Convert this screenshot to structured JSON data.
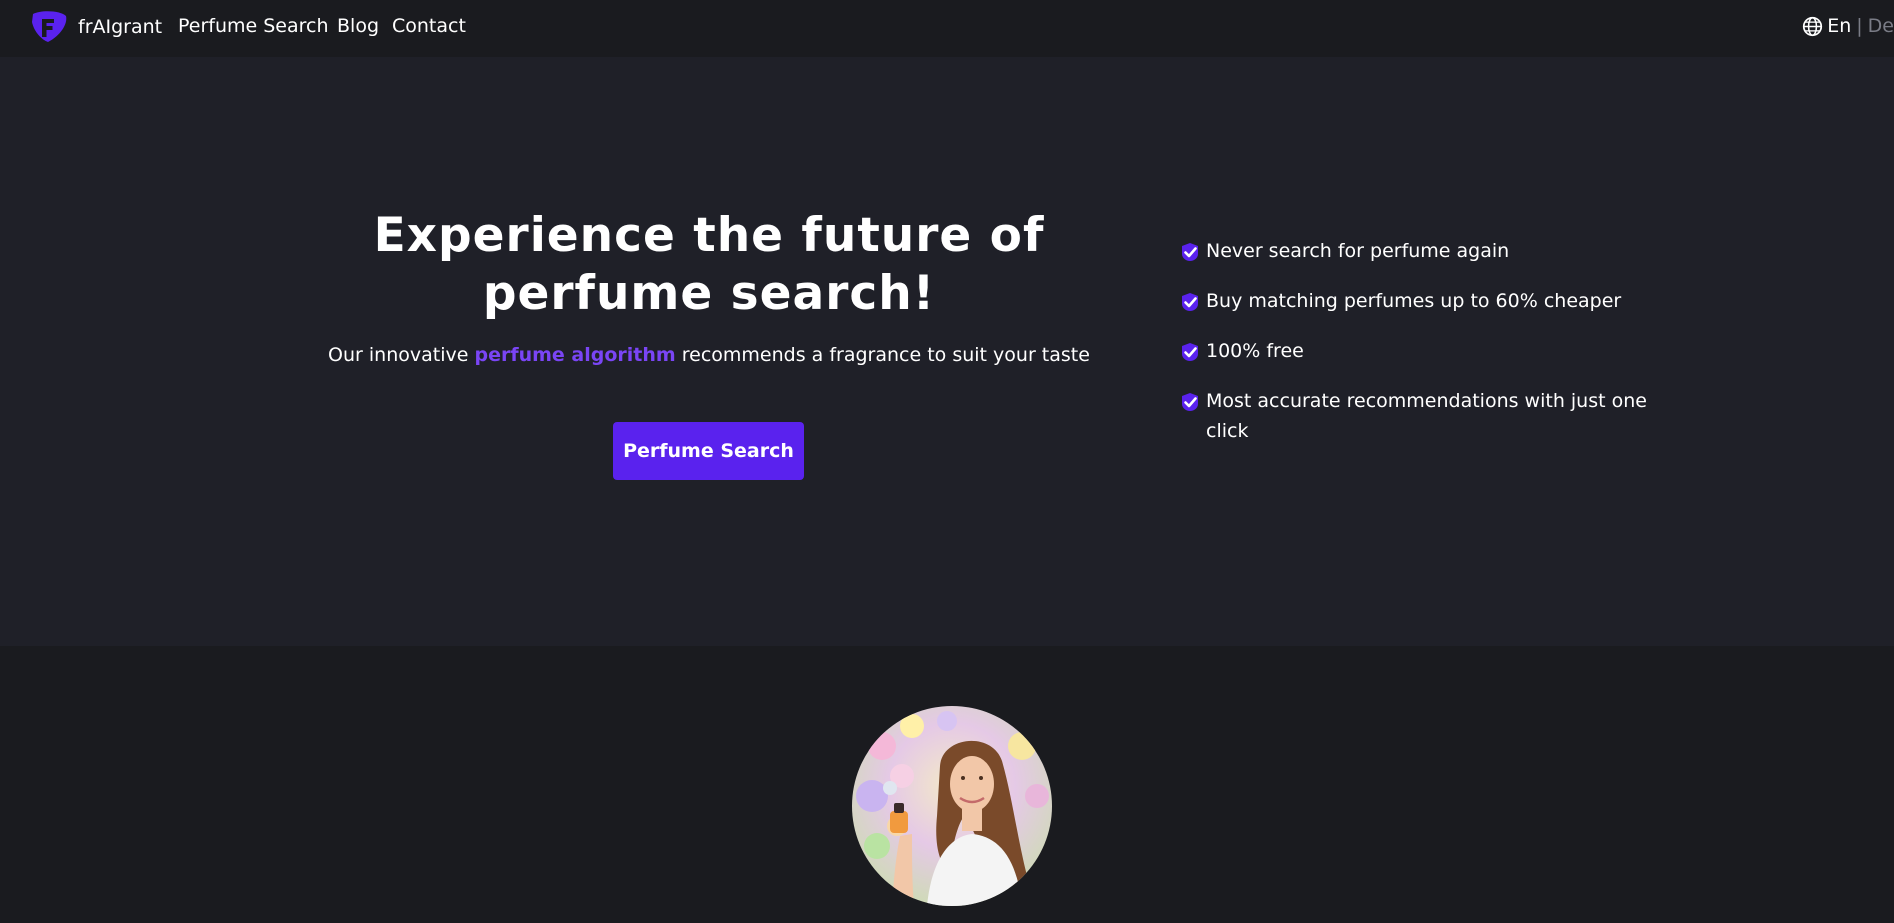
{
  "brand": {
    "name": "frAIgrant",
    "logo_icon": "logo-f-icon"
  },
  "nav": {
    "links": [
      "Perfume Search",
      "Blog",
      "Contact"
    ]
  },
  "language": {
    "icon": "globe-icon",
    "current": "En",
    "separator": "|",
    "other": "De"
  },
  "hero": {
    "title": "Experience the future of perfume search!",
    "subtitle_prefix": "Our innovative ",
    "subtitle_highlight": "perfume algorithm",
    "subtitle_suffix": " recommends a fragrance to suit your taste",
    "cta_label": "Perfume Search"
  },
  "features": [
    "Never search for perfume again",
    "Buy matching perfumes up to 60% cheaper",
    "100% free",
    "Most accurate recommendations with just one click"
  ],
  "colors": {
    "accent": "#5a22ee",
    "accent_text": "#7a45f5",
    "nav_bg": "#1a1b1f",
    "hero_bg": "#1f2028",
    "muted": "#7a7c86"
  }
}
